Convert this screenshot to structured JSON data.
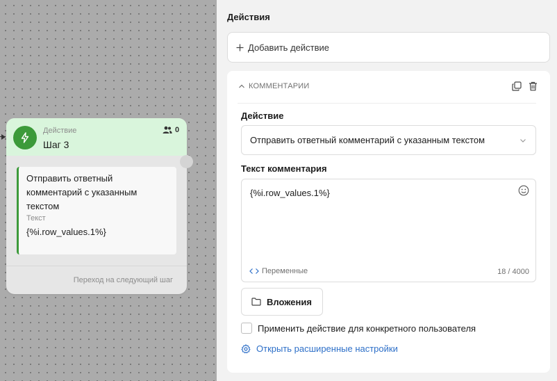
{
  "canvas": {
    "node": {
      "type_label": "Действие",
      "title": "Шаг 3",
      "users_count": "0",
      "card_text": "Отправить ответный комментарий с указанным текстом",
      "card_label": "Текст",
      "card_value": "{%i.row_values.1%}",
      "next_step_label": "Переход на следующий шаг"
    }
  },
  "panel": {
    "title": "Действия",
    "add_action_label": "Добавить действие",
    "section": {
      "header": "КОММЕНТАРИИ",
      "action_label": "Действие",
      "action_selected": "Отправить ответный комментарий с указанным текстом",
      "comment_label": "Текст комментария",
      "comment_value": "{%i.row_values.1%}",
      "variables_label": "Переменные",
      "char_count": "18 / 4000",
      "attachments_label": "Вложения",
      "specific_user_label": "Применить действие для конкретного пользователя",
      "advanced_label": "Открыть расширенные настройки"
    }
  },
  "colors": {
    "accent_green": "#3c9a3a",
    "node_header_bg": "#d9f5dc",
    "link_blue": "#2d6fc8"
  },
  "icons": {
    "node_icon": "lightning-icon",
    "users": "users-icon",
    "plus": "plus-icon",
    "collapse": "chevron-up-icon",
    "copy": "copy-icon",
    "delete": "trash-icon",
    "dropdown": "chevron-down-icon",
    "emoji": "emoji-icon",
    "variables": "code-icon",
    "attachments": "folder-icon",
    "settings": "gear-icon"
  }
}
